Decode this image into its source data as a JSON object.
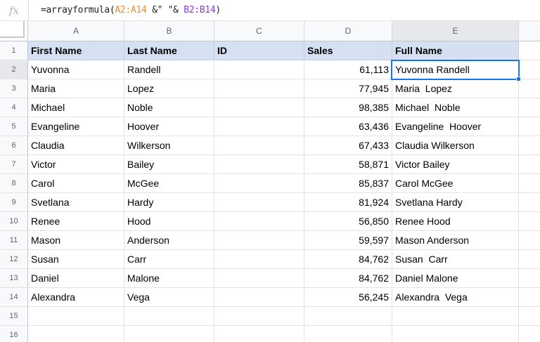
{
  "formula_bar": {
    "fx_label": "fx",
    "formula": "=arrayformula(A2:A14 &\" \"& B2:B14)",
    "parts": [
      {
        "text": "=arrayformula(",
        "color": "#202124"
      },
      {
        "text": "A2:A14",
        "color": "#EC8E2E"
      },
      {
        "text": " &\" \"& ",
        "color": "#202124"
      },
      {
        "text": "B2:B14",
        "color": "#9334E6"
      },
      {
        "text": ")",
        "color": "#202124"
      }
    ]
  },
  "columns": {
    "letters": [
      "A",
      "B",
      "C",
      "D",
      "E"
    ],
    "selected_column": "E"
  },
  "header_row": {
    "num": "1",
    "cells": [
      "First Name",
      "Last Name",
      "ID",
      "Sales",
      "Full Name"
    ],
    "bg": "#D5E1F2"
  },
  "rows": [
    {
      "num": "2",
      "a": "Yuvonna",
      "b": "Randell",
      "c": "",
      "d": "61,113",
      "e": "Yuvonna Randell"
    },
    {
      "num": "3",
      "a": "Maria",
      "b": "Lopez",
      "c": "",
      "d": "77,945",
      "e": "Maria  Lopez"
    },
    {
      "num": "4",
      "a": "Michael",
      "b": "Noble",
      "c": "",
      "d": "98,385",
      "e": "Michael  Noble"
    },
    {
      "num": "5",
      "a": "Evangeline",
      "b": "Hoover",
      "c": "",
      "d": "63,436",
      "e": "Evangeline  Hoover"
    },
    {
      "num": "6",
      "a": "Claudia",
      "b": "Wilkerson",
      "c": "",
      "d": "67,433",
      "e": "Claudia Wilkerson"
    },
    {
      "num": "7",
      "a": "Victor",
      "b": "Bailey",
      "c": "",
      "d": "58,871",
      "e": "Victor Bailey"
    },
    {
      "num": "8",
      "a": "Carol",
      "b": "McGee",
      "c": "",
      "d": "85,837",
      "e": "Carol McGee"
    },
    {
      "num": "9",
      "a": "Svetlana",
      "b": "Hardy",
      "c": "",
      "d": "81,924",
      "e": "Svetlana Hardy"
    },
    {
      "num": "10",
      "a": "Renee",
      "b": "Hood",
      "c": "",
      "d": "56,850",
      "e": "Renee Hood"
    },
    {
      "num": "11",
      "a": "Mason",
      "b": "Anderson",
      "c": "",
      "d": "59,597",
      "e": "Mason Anderson"
    },
    {
      "num": "12",
      "a": "Susan",
      "b": "Carr",
      "c": "",
      "d": "84,762",
      "e": "Susan  Carr"
    },
    {
      "num": "13",
      "a": "Daniel",
      "b": "Malone",
      "c": "",
      "d": "84,762",
      "e": "Daniel Malone"
    },
    {
      "num": "14",
      "a": "Alexandra",
      "b": "Vega",
      "c": "",
      "d": "56,245",
      "e": "Alexandra  Vega"
    },
    {
      "num": "15",
      "a": "",
      "b": "",
      "c": "",
      "d": "",
      "e": ""
    },
    {
      "num": "16",
      "a": "",
      "b": "",
      "c": "",
      "d": "",
      "e": ""
    }
  ],
  "selection": {
    "cell": "E2",
    "selected_row": "2",
    "value": "Yuvonna Randell",
    "border_color": "#1A73E8"
  },
  "colors": {
    "header_row_bg": "#D5E1F2",
    "grid_line": "#E2E2E2",
    "header_bg": "#F8F9FA",
    "selected_header_bg": "#E6E8EB",
    "range1": "#EC8E2E",
    "range2": "#9334E6",
    "accent": "#1A73E8"
  }
}
